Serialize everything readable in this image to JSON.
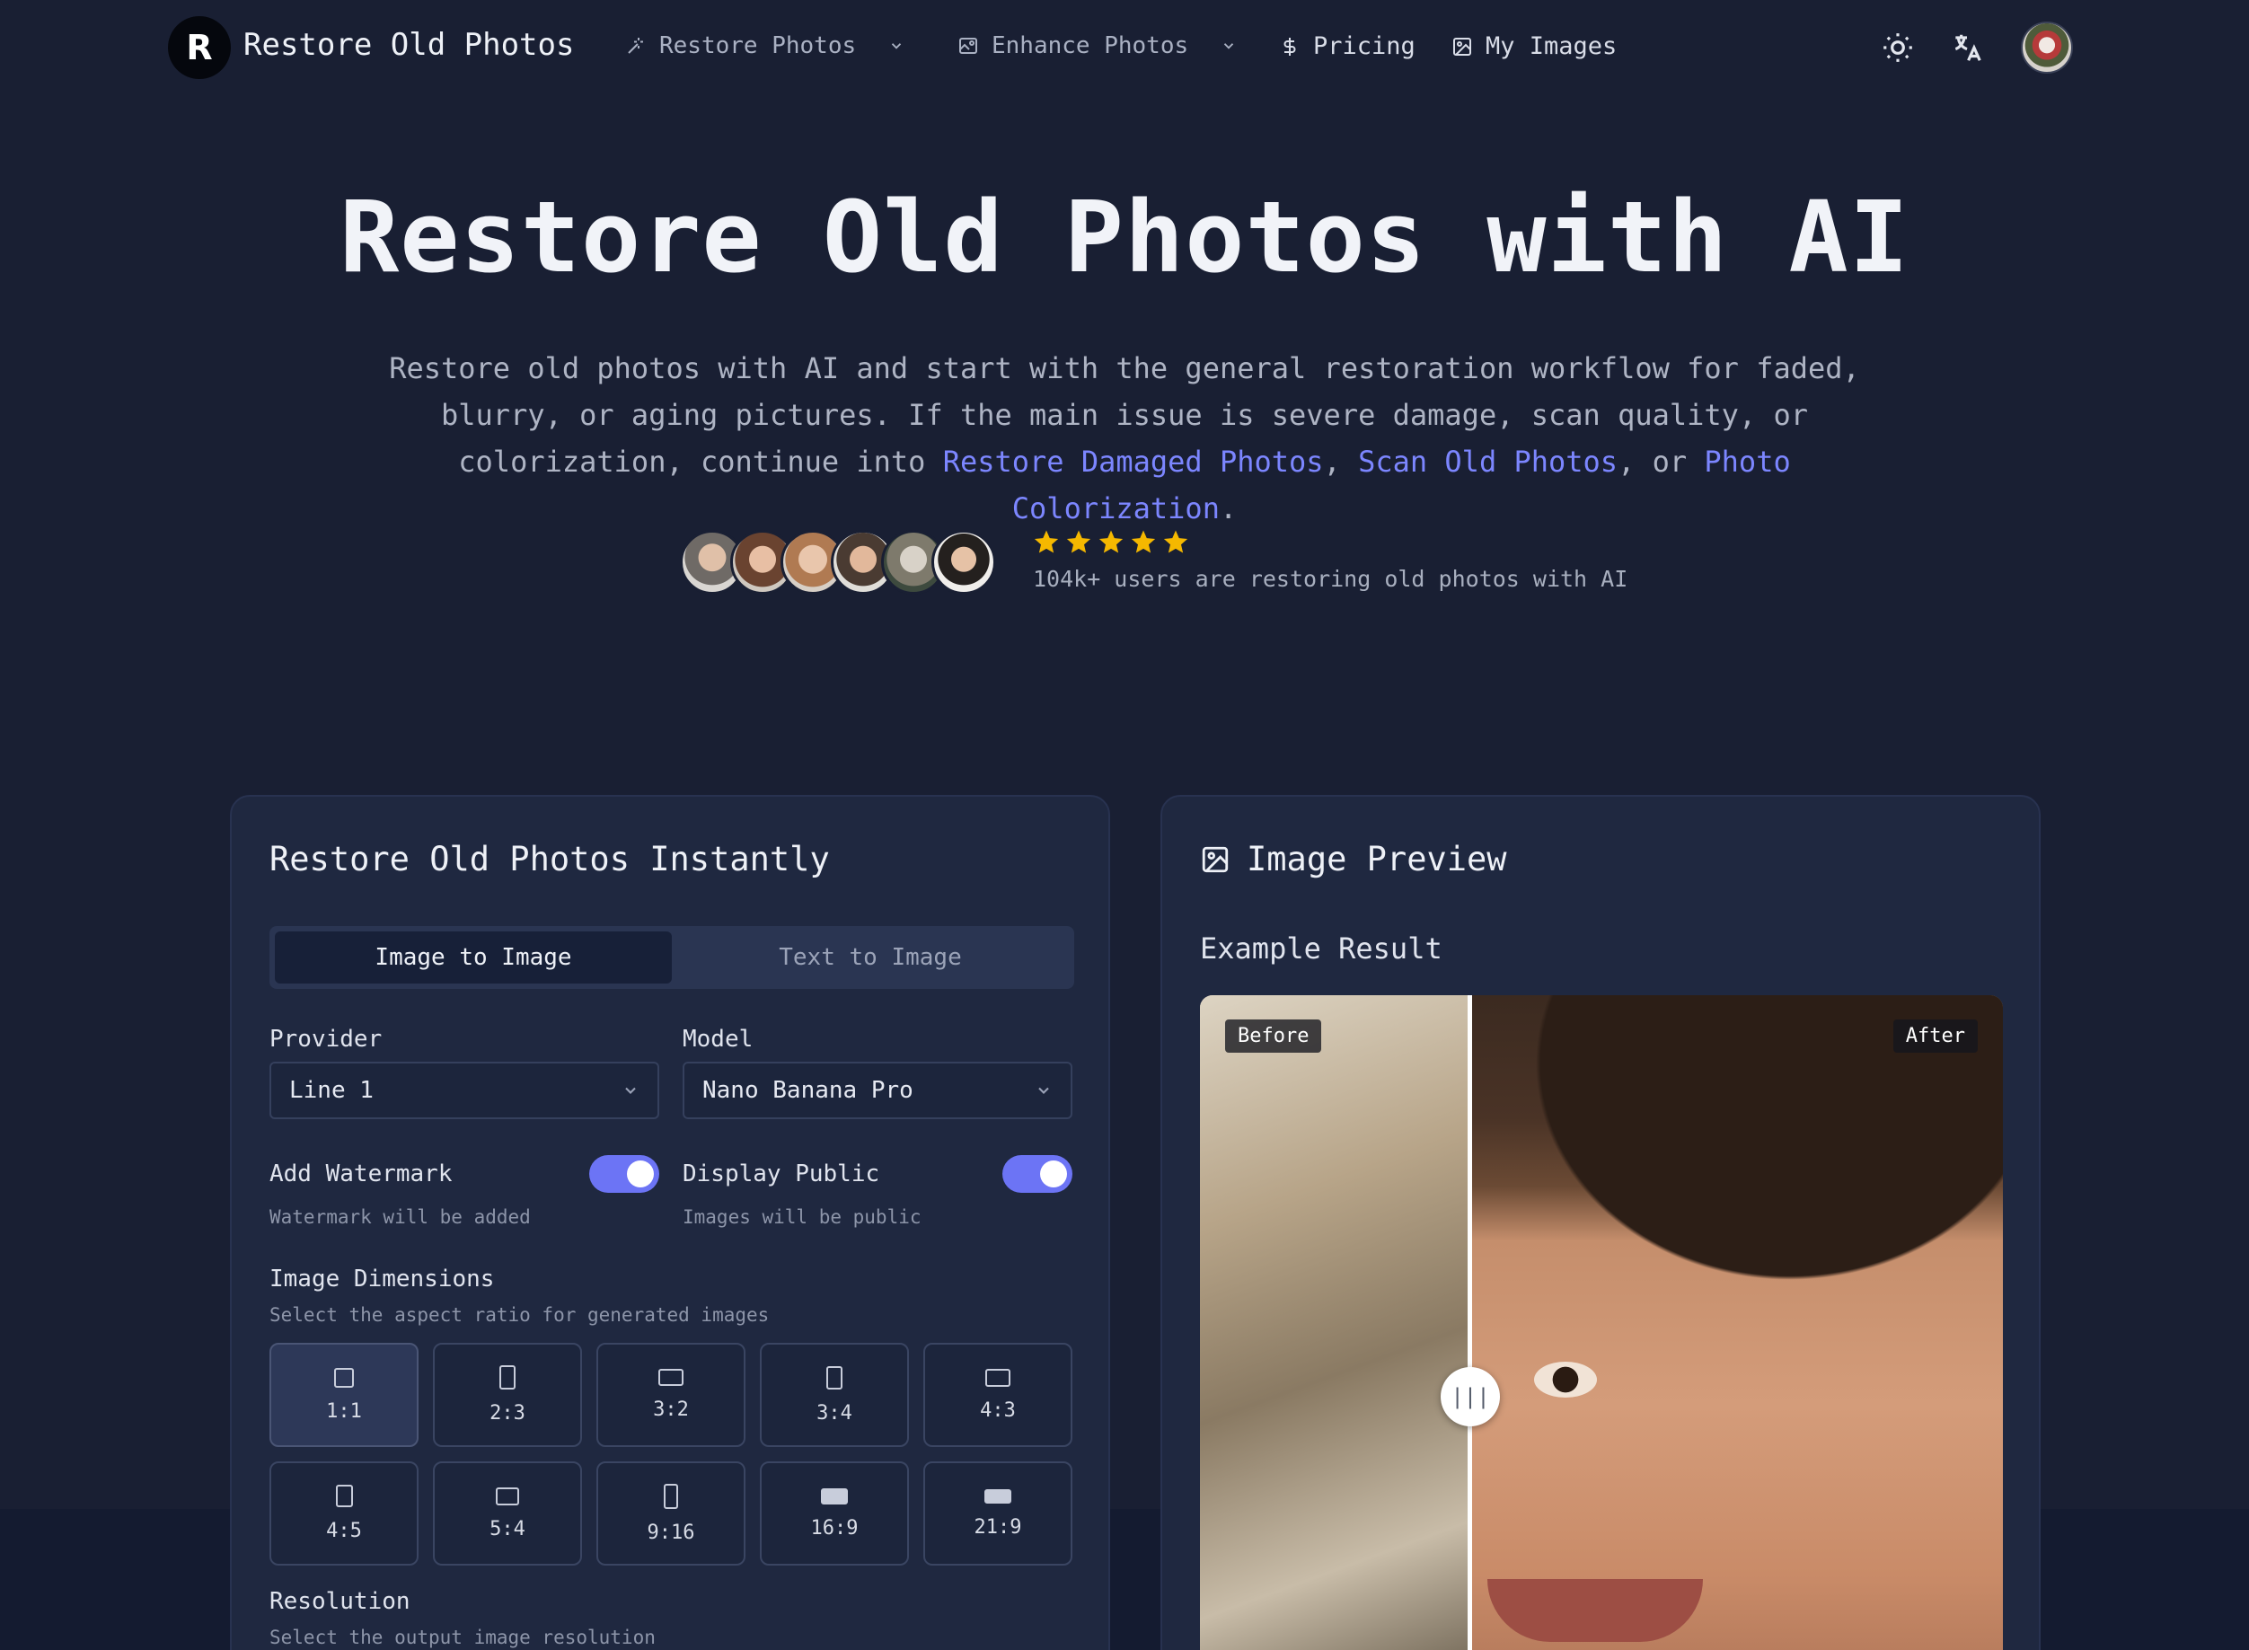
{
  "nav": {
    "logo_letter": "R",
    "brand": "Restore Old Photos",
    "items": [
      {
        "label": "Restore Photos"
      },
      {
        "label": "Enhance Photos"
      },
      {
        "label": "Pricing"
      },
      {
        "label": "My Images"
      }
    ]
  },
  "hero": {
    "title": "Restore Old Photos with AI",
    "desc_prefix": "Restore old photos with AI and start with the general restoration workflow for faded, blurry, or aging pictures. If the main issue is severe damage, scan quality, or colorization, continue into ",
    "link1": "Restore Damaged Photos",
    "sep1": ", ",
    "link2": "Scan Old Photos",
    "sep2": ", or ",
    "link3": "Photo Colorization",
    "desc_suffix": ".",
    "users_text": "104k+ users are restoring old photos with AI",
    "rating": 5
  },
  "left_card": {
    "title": "Restore Old Photos Instantly",
    "tabs": [
      {
        "label": "Image to Image",
        "active": true
      },
      {
        "label": "Text to Image",
        "active": false
      }
    ],
    "provider": {
      "label": "Provider",
      "value": "Line 1"
    },
    "model": {
      "label": "Model",
      "value": "Nano Banana Pro"
    },
    "watermark": {
      "label": "Add Watermark",
      "hint": "Watermark will be added",
      "on": true
    },
    "public": {
      "label": "Display Public",
      "hint": "Images will be public",
      "on": true
    },
    "dimensions": {
      "label": "Image Dimensions",
      "hint": "Select the aspect ratio for generated images",
      "ratios": [
        "1:1",
        "2:3",
        "3:2",
        "3:4",
        "4:3",
        "4:5",
        "5:4",
        "9:16",
        "16:9",
        "21:9"
      ],
      "selected": "1:1"
    },
    "resolution": {
      "label": "Resolution",
      "hint": "Select the output image resolution"
    }
  },
  "right_card": {
    "title": "Image Preview",
    "subtitle": "Example Result",
    "before_label": "Before",
    "after_label": "After"
  },
  "colors": {
    "bg": "#191f33",
    "card": "#1f2840",
    "accent": "#6c74f5",
    "link": "#7c86ff",
    "star": "#f5b800"
  }
}
